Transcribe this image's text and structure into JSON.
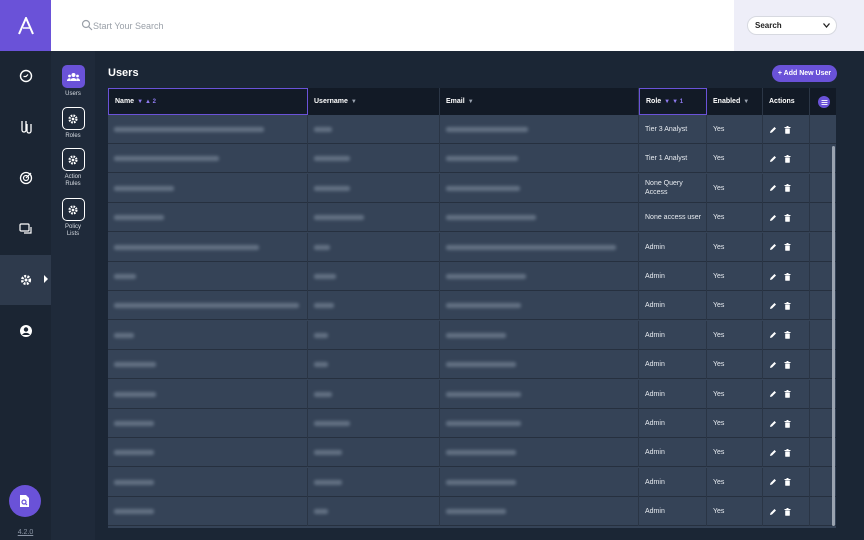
{
  "brand": {
    "logo_letter": "A"
  },
  "search": {
    "placeholder": "Start Your Search",
    "scope": "Search"
  },
  "leftnav": {
    "version": "4.2.0"
  },
  "subnav": {
    "items": [
      {
        "label": "Users"
      },
      {
        "label": "Roles"
      },
      {
        "label": "Action Rules"
      },
      {
        "label": "Policy Lists"
      }
    ]
  },
  "page": {
    "title": "Users",
    "add_button": "+ Add New User"
  },
  "table": {
    "headers": {
      "name": "Name",
      "name_sort": "▲ 2",
      "username": "Username",
      "email": "Email",
      "role": "Role",
      "role_sort": "▼ 1",
      "enabled": "Enabled",
      "actions": "Actions"
    },
    "rows": [
      {
        "role": "Tier 3 Analyst",
        "enabled": "Yes"
      },
      {
        "role": "Tier 1 Analyst",
        "enabled": "Yes"
      },
      {
        "role": "None Query Access",
        "enabled": "Yes"
      },
      {
        "role": "None access user",
        "enabled": "Yes"
      },
      {
        "role": "Admin",
        "enabled": "Yes"
      },
      {
        "role": "Admin",
        "enabled": "Yes"
      },
      {
        "role": "Admin",
        "enabled": "Yes"
      },
      {
        "role": "Admin",
        "enabled": "Yes"
      },
      {
        "role": "Admin",
        "enabled": "Yes"
      },
      {
        "role": "Admin",
        "enabled": "Yes"
      },
      {
        "role": "Admin",
        "enabled": "Yes"
      },
      {
        "role": "Admin",
        "enabled": "Yes"
      },
      {
        "role": "Admin",
        "enabled": "Yes"
      },
      {
        "role": "Admin",
        "enabled": "Yes"
      }
    ]
  },
  "colors": {
    "accent": "#6a52d8",
    "background": "#1b2635",
    "row": "#354357",
    "header": "#121a26"
  }
}
